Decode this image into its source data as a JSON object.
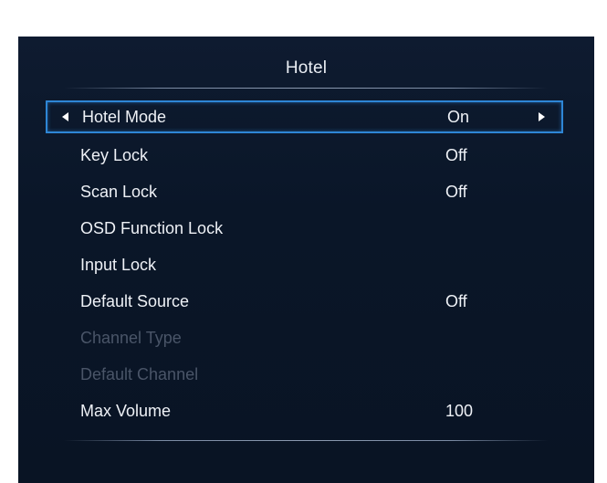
{
  "menu": {
    "title": "Hotel",
    "items": [
      {
        "label": "Hotel Mode",
        "value": "On",
        "selected": true,
        "enabled": true
      },
      {
        "label": "Key Lock",
        "value": "Off",
        "enabled": true
      },
      {
        "label": "Scan Lock",
        "value": "Off",
        "enabled": true
      },
      {
        "label": "OSD Function Lock",
        "value": "",
        "enabled": true
      },
      {
        "label": "Input Lock",
        "value": "",
        "enabled": true
      },
      {
        "label": "Default Source",
        "value": "Off",
        "enabled": true
      },
      {
        "label": "Channel Type",
        "value": "",
        "enabled": false
      },
      {
        "label": "Default Channel",
        "value": "",
        "enabled": false
      },
      {
        "label": "Max Volume",
        "value": "100",
        "enabled": true
      }
    ]
  },
  "colors": {
    "background": "#0a1628",
    "text": "#eef1f6",
    "disabled_text": "#4a5568",
    "selection_border": "#2e86d6"
  },
  "icons": {
    "left_arrow": "triangle-left-icon",
    "right_arrow": "triangle-right-icon"
  }
}
